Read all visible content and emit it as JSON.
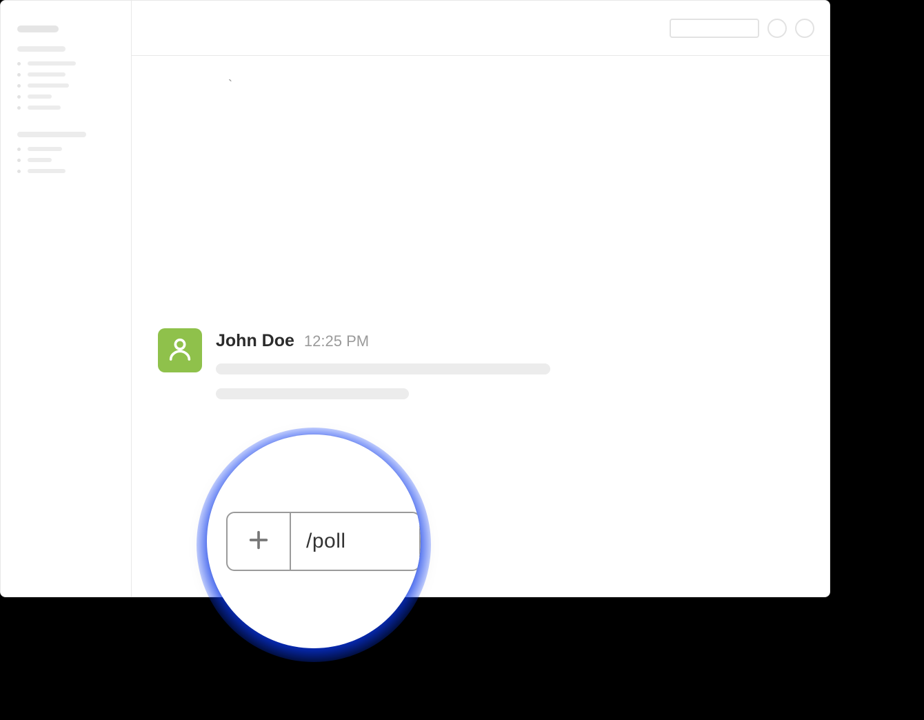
{
  "message": {
    "author": "John Doe",
    "time": "12:25 PM"
  },
  "composer": {
    "command": "/poll",
    "plus_label": "+"
  },
  "icons": {
    "avatar": "person-icon",
    "plus": "plus-icon"
  }
}
